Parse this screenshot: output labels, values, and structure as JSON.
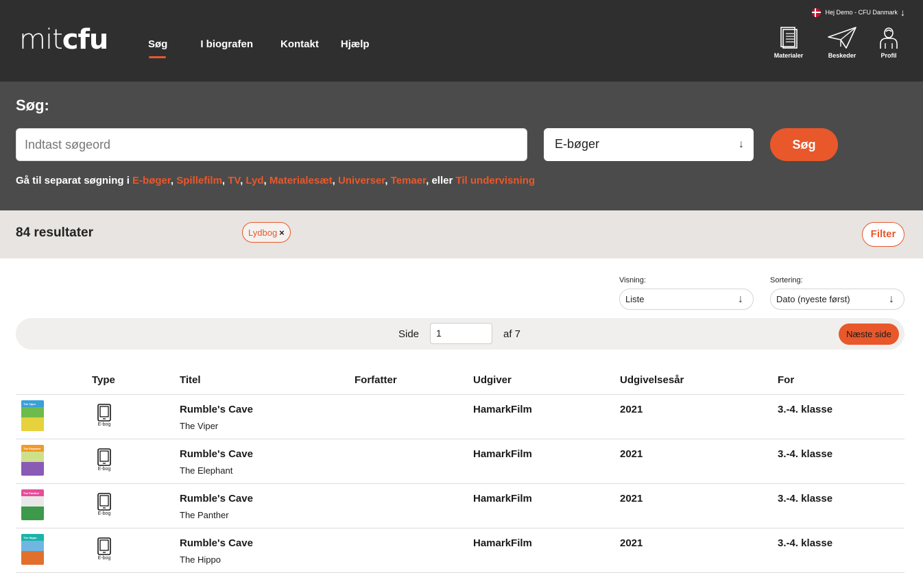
{
  "header": {
    "logo_light": "mit",
    "logo_bold": "cfu",
    "nav": [
      "Søg",
      "I biografen",
      "Kontakt",
      "Hjælp"
    ],
    "active_nav": "Søg",
    "greeting": "Hej Demo - CFU Danmark",
    "tools": [
      {
        "label": "Materialer",
        "icon": "book-icon"
      },
      {
        "label": "Beskeder",
        "icon": "paper-plane-icon"
      },
      {
        "label": "Profil",
        "icon": "person-icon"
      }
    ]
  },
  "search": {
    "title": "Søg:",
    "placeholder": "Indtast søgeord",
    "category": "E-bøger",
    "button": "Søg",
    "quicklinks_prefix": "Gå til separat søgning i",
    "quicklinks": [
      "E-bøger",
      "Spillefilm",
      "TV",
      "Lyd",
      "Materialesæt",
      "Universer",
      "Temaer"
    ],
    "quicklinks_joiner": "eller",
    "quicklinks_last": "Til undervisning"
  },
  "results": {
    "count_label": "84 resultater",
    "active_filter": "Lydbog",
    "filter_button": "Filter"
  },
  "view": {
    "visning_label": "Visning:",
    "visning_value": "Liste",
    "sortering_label": "Sortering:",
    "sortering_value": "Dato (nyeste først)"
  },
  "pager": {
    "side_label": "Side",
    "current_page": "1",
    "of_label": "af 7",
    "next_label": "Næste side"
  },
  "table": {
    "headers": [
      "Type",
      "Titel",
      "Forfatter",
      "Udgiver",
      "Udgivelsesår",
      "For"
    ],
    "rows": [
      {
        "type": "E-bog",
        "title": "Rumble's Cave",
        "subtitle": "The Viper",
        "author": "",
        "publisher": "HamarkFilm",
        "year": "2021",
        "for": "3.-4. klasse",
        "cover_title": "The Viper",
        "cover_top": "#3aa0d8",
        "cover_bottom": "#e6d23c",
        "cover_mid": "#6dbb4a"
      },
      {
        "type": "E-bog",
        "title": "Rumble's Cave",
        "subtitle": "The Elephant",
        "author": "",
        "publisher": "HamarkFilm",
        "year": "2021",
        "for": "3.-4. klasse",
        "cover_title": "The Elephant",
        "cover_top": "#f09a2a",
        "cover_bottom": "#8a5bb5",
        "cover_mid": "#cfe08a"
      },
      {
        "type": "E-bog",
        "title": "Rumble's Cave",
        "subtitle": "The Panther",
        "author": "",
        "publisher": "HamarkFilm",
        "year": "2021",
        "for": "3.-4. klasse",
        "cover_title": "The Panther",
        "cover_top": "#e64d9b",
        "cover_bottom": "#3c9a4a",
        "cover_mid": "#e8e8e8"
      },
      {
        "type": "E-bog",
        "title": "Rumble's Cave",
        "subtitle": "The Hippo",
        "author": "",
        "publisher": "HamarkFilm",
        "year": "2021",
        "for": "3.-4. klasse",
        "cover_title": "The Hippo",
        "cover_top": "#1bb3a8",
        "cover_bottom": "#e0702c",
        "cover_mid": "#6fb6e0"
      }
    ]
  },
  "colors": {
    "accent": "#e8582b",
    "header_bg": "#2f2f2f",
    "search_bg": "#4b4b4b",
    "results_bg": "#e7e4e1"
  }
}
